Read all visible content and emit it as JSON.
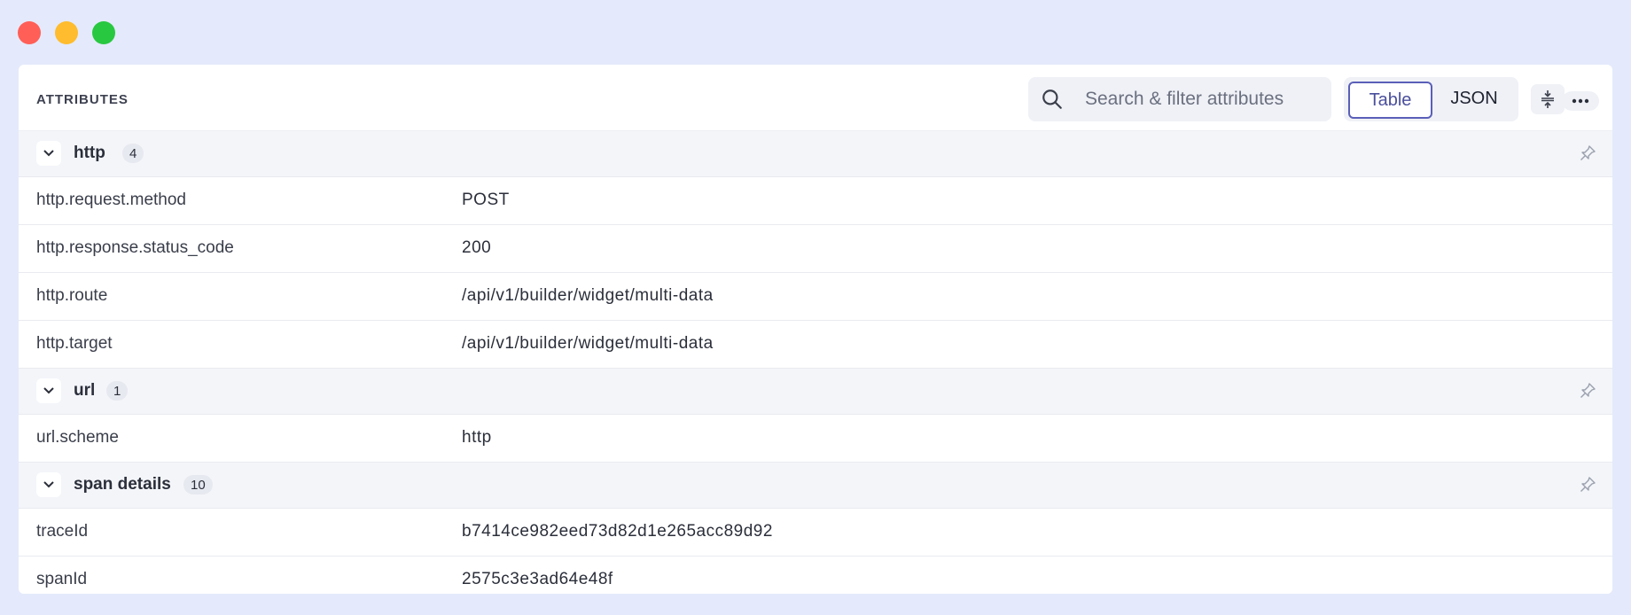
{
  "window": {
    "traffic_lights": [
      "close",
      "minimize",
      "maximize"
    ]
  },
  "header": {
    "title": "ATTRIBUTES",
    "search_placeholder": "Search & filter attributes",
    "view_toggle": {
      "table_label": "Table",
      "json_label": "JSON",
      "selected": "Table"
    }
  },
  "groups": [
    {
      "name": "http",
      "count": "4",
      "rows": [
        {
          "key": "http.request.method",
          "value": "POST"
        },
        {
          "key": "http.response.status_code",
          "value": "200"
        },
        {
          "key": "http.route",
          "value": "/api/v1/builder/widget/multi-data"
        },
        {
          "key": "http.target",
          "value": "/api/v1/builder/widget/multi-data"
        }
      ]
    },
    {
      "name": "url",
      "count": "1",
      "rows": [
        {
          "key": "url.scheme",
          "value": "http"
        }
      ]
    },
    {
      "name": "span details",
      "count": "10",
      "rows": [
        {
          "key": "traceId",
          "value": "b7414ce982eed73d82d1e265acc89d92"
        },
        {
          "key": "spanId",
          "value": "2575c3e3ad64e48f"
        }
      ]
    }
  ],
  "colors": {
    "background": "#e4eafb",
    "accent": "#5a5fb8",
    "group_bg": "#f3f5f9"
  }
}
